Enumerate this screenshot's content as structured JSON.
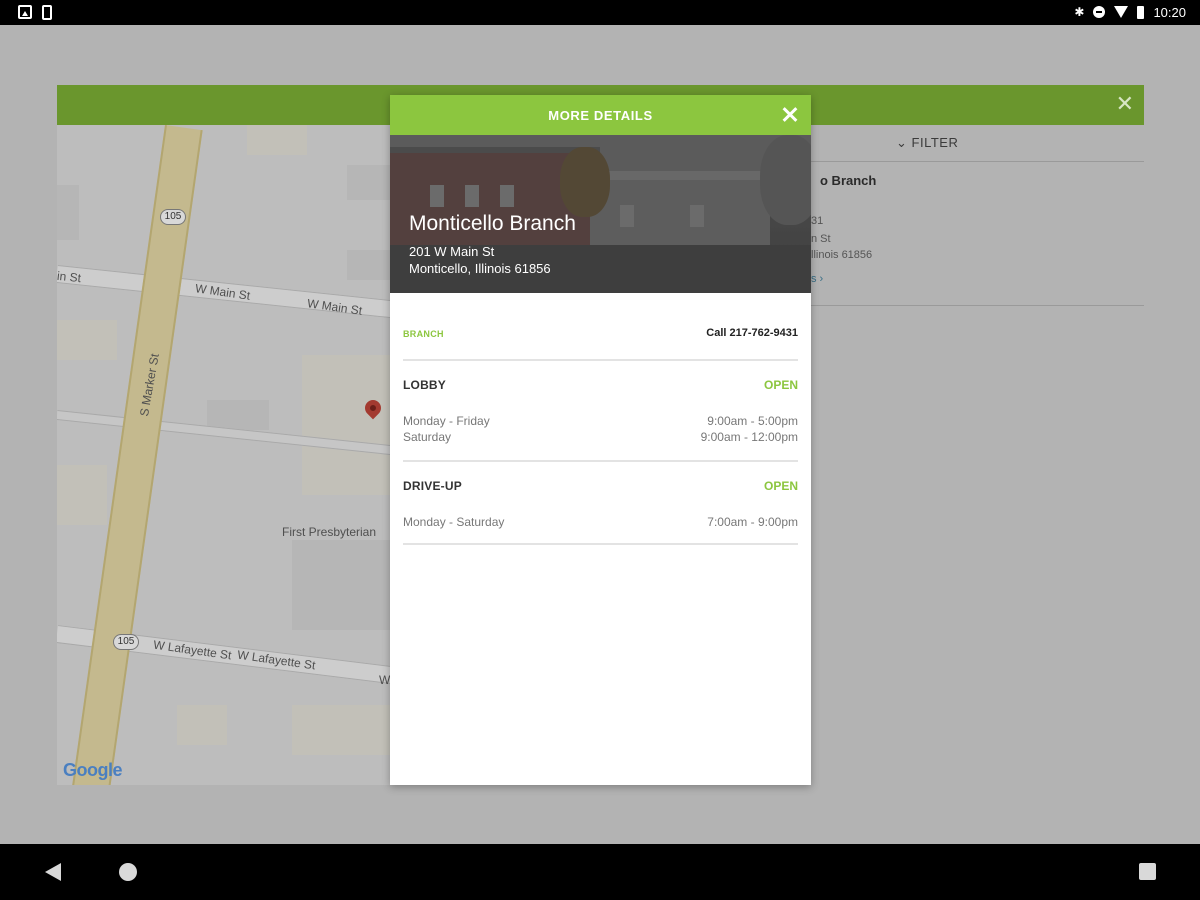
{
  "status_bar": {
    "time": "10:20",
    "icons": [
      "image-notification-icon",
      "phone-notification-icon",
      "bluetooth-icon",
      "do-not-disturb-icon",
      "wifi-icon",
      "battery-icon"
    ]
  },
  "background": {
    "filter_label": "FILTER",
    "branch_title_partial": "o Branch",
    "address_partial_1": "31",
    "address_partial_2": "n St",
    "address_partial_3": "llinois 61856",
    "link_partial": "s ›",
    "map": {
      "street_labels": [
        "S Marker St",
        "W Main St",
        "W Main St",
        "in St",
        "W Lafayette St",
        "W Lafayette St",
        "First Presbyterian",
        "W"
      ],
      "route_shields": [
        "105",
        "105"
      ],
      "logo": "Google"
    }
  },
  "modal": {
    "title": "MORE DETAILS",
    "branch_name": "Monticello Branch",
    "address_line1": "201 W Main St",
    "address_line2": "Monticello, Illinois 61856",
    "type_tag": "BRANCH",
    "call_label": "Call 217-762-9431",
    "sections": [
      {
        "title": "LOBBY",
        "status": "OPEN",
        "rows": [
          {
            "days": "Monday - Friday",
            "hours": "9:00am - 5:00pm"
          },
          {
            "days": "Saturday",
            "hours": "9:00am - 12:00pm"
          }
        ]
      },
      {
        "title": "DRIVE-UP",
        "status": "OPEN",
        "rows": [
          {
            "days": "Monday - Saturday",
            "hours": "7:00am - 9:00pm"
          }
        ]
      }
    ]
  },
  "colors": {
    "accent_green": "#8cc63f",
    "header_green_dimmed": "#6a962d",
    "dim_overlay": "#b3b3b3"
  }
}
